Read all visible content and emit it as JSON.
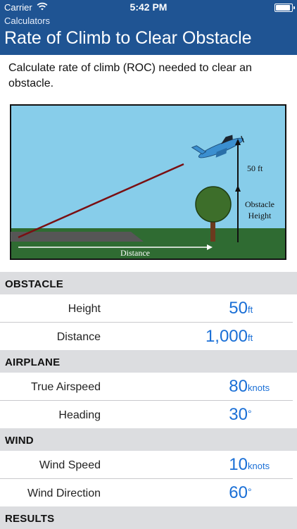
{
  "status_bar": {
    "carrier": "Carrier",
    "time": "5:42 PM",
    "battery_level": 1.0
  },
  "nav": {
    "back_label": "Calculators",
    "title": "Rate of Climb to Clear Obstacle"
  },
  "description": "Calculate rate of climb (ROC) needed to clear an obstacle.",
  "diagram": {
    "label_50ft": "50 ft",
    "label_obstacle_line1": "Obstacle",
    "label_obstacle_line2": "Height",
    "label_distance": "Distance",
    "colors": {
      "sky": "#87cdea",
      "ground": "#2f6b32",
      "runway": "#565656",
      "path": "#7a0f12",
      "plane": "#3b8fd0",
      "tree": "#3d6e2a",
      "trunk": "#6b3a1e"
    }
  },
  "sections": {
    "obstacle": {
      "title": "OBSTACLE",
      "rows": [
        {
          "label": "Height",
          "value": "50",
          "unit": "ft"
        },
        {
          "label": "Distance",
          "value": "1,000",
          "unit": "ft"
        }
      ]
    },
    "airplane": {
      "title": "AIRPLANE",
      "rows": [
        {
          "label": "True Airspeed",
          "value": "80",
          "unit": "knots"
        },
        {
          "label": "Heading",
          "value": "30",
          "unit": "°"
        }
      ]
    },
    "wind": {
      "title": "WIND",
      "rows": [
        {
          "label": "Wind Speed",
          "value": "10",
          "unit": "knots"
        },
        {
          "label": "Wind Direction",
          "value": "60",
          "unit": "°"
        }
      ]
    },
    "results": {
      "title": "RESULTS"
    }
  },
  "colors": {
    "nav_bar": "#1f5493",
    "accent_value": "#1a6fd6",
    "section_bg": "#dcdde0"
  }
}
